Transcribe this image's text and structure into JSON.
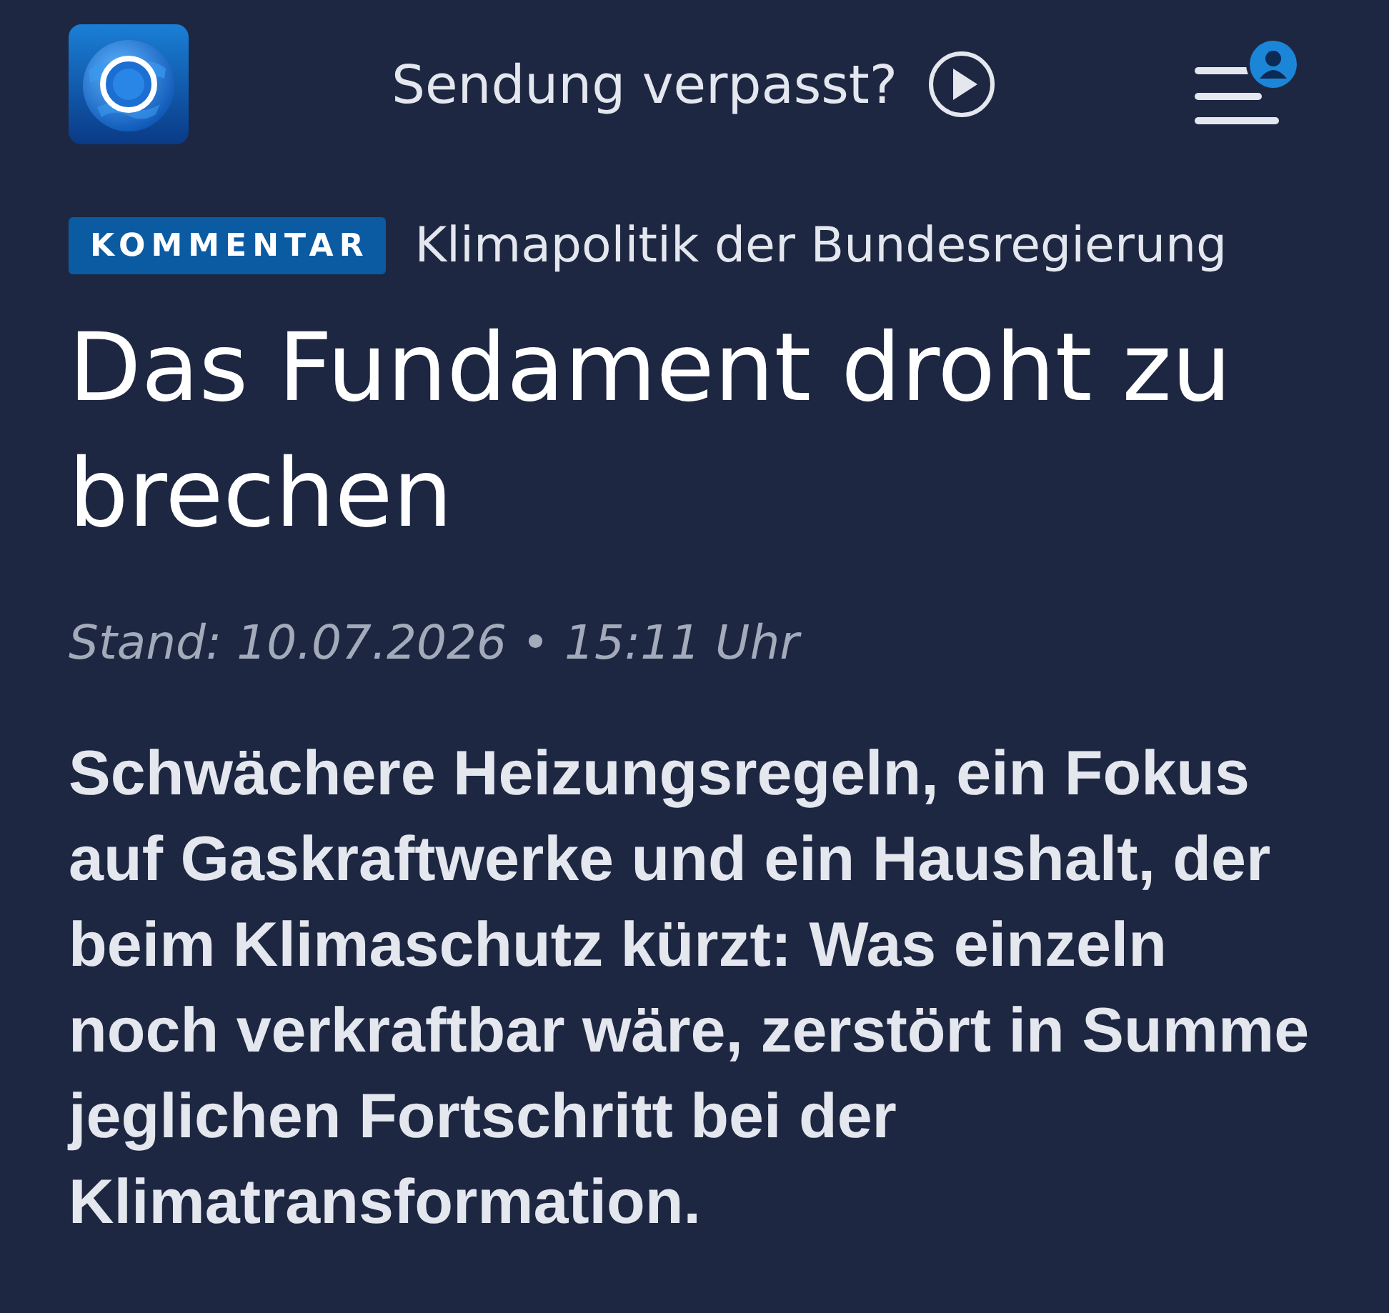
{
  "header": {
    "missed_show_link": "Sendung verpasst?"
  },
  "article": {
    "tag": "KOMMENTAR",
    "topline": "Klimapolitik der Bundesregierung",
    "headline": "Das Fundament droht zu brechen",
    "date_line": "Stand: 10.07.2026 • 15:11 Uhr",
    "lead": "Schwächere Heizungsregeln, ein Fokus auf Gaskraftwerke und ein Haushalt, der beim Klimaschutz kürzt: Was einzeln noch verkraftbar wäre, zerstört in Summe jeglichen Fortschritt bei der Klimatransformation."
  }
}
